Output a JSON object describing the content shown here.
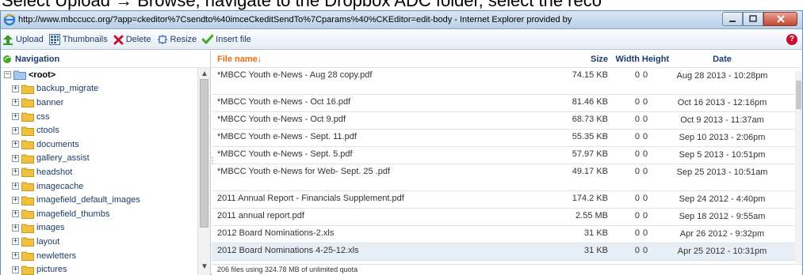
{
  "page_caption": "Select Upload → Browse, navigate to the Dropbox ADC folder, select the reco",
  "window": {
    "title": "http://www.mbccucc.org/?app=ckeditor%7Csendto%40imceCkeditSendTo%7Cparams%40%CKEditor=edit-body - Internet Explorer provided by"
  },
  "toolbar": {
    "upload_label": "Upload",
    "thumbnails_label": "Thumbnails",
    "delete_label": "Delete",
    "resize_label": "Resize",
    "insert_label": "Insert file",
    "help_label": "?"
  },
  "nav": {
    "header": "Navigation",
    "root": "<root>",
    "folders": [
      "backup_migrate",
      "banner",
      "css",
      "ctools",
      "documents",
      "gallery_assist",
      "headshot",
      "imagecache",
      "imagefield_default_images",
      "imagefield_thumbs",
      "images",
      "layout",
      "newletters",
      "pictures"
    ]
  },
  "files": {
    "columns": {
      "name": "File name",
      "size": "Size",
      "width": "Width",
      "height": "Height",
      "date": "Date"
    },
    "rows": [
      {
        "name": "*MBCC Youth e-News - Aug 28 copy.pdf",
        "size": "74.15 KB",
        "width": "0",
        "height": "0",
        "date": "Aug 28 2013 - 10:28pm"
      },
      {
        "name": "*MBCC Youth e-News - Oct 16.pdf",
        "size": "81.46 KB",
        "width": "0",
        "height": "0",
        "date": "Oct 16 2013 - 12:16pm"
      },
      {
        "name": "*MBCC Youth e-News - Oct 9.pdf",
        "size": "68.73 KB",
        "width": "0",
        "height": "0",
        "date": "Oct 9 2013 - 11:37am"
      },
      {
        "name": "*MBCC Youth e-News - Sept. 11.pdf",
        "size": "55.35 KB",
        "width": "0",
        "height": "0",
        "date": "Sep 10 2013 - 2:06pm"
      },
      {
        "name": "*MBCC Youth e-News - Sept. 5.pdf",
        "size": "57.97 KB",
        "width": "0",
        "height": "0",
        "date": "Sep 5 2013 - 10:51pm"
      },
      {
        "name": "*MBCC Youth e-News for Web- Sept. 25 .pdf",
        "size": "49.17 KB",
        "width": "0",
        "height": "0",
        "date": "Sep 25 2013 - 10:51am"
      },
      {
        "name": "2011 Annual Report - Financials Supplement.pdf",
        "size": "174.2 KB",
        "width": "0",
        "height": "0",
        "date": "Sep 24 2012 - 4:40pm"
      },
      {
        "name": "2011 annual report.pdf",
        "size": "2.55 MB",
        "width": "0",
        "height": "0",
        "date": "Sep 18 2012 - 9:55am"
      },
      {
        "name": "2012 Board Nominations-2.xls",
        "size": "31 KB",
        "width": "0",
        "height": "0",
        "date": "Apr 26 2012 - 9:32pm"
      },
      {
        "name": "2012 Board Nominations 4-25-12.xls",
        "size": "31 KB",
        "width": "0",
        "height": "0",
        "date": "Apr 25 2012 - 10:31pm"
      }
    ]
  },
  "status": "206 files using 324.78 MB of unlimited quota",
  "colors": {
    "accent_orange": "#e86c12",
    "link_blue": "#1d3c69",
    "delete_red": "#c8102e",
    "folder_yellow": "#f0c040"
  }
}
